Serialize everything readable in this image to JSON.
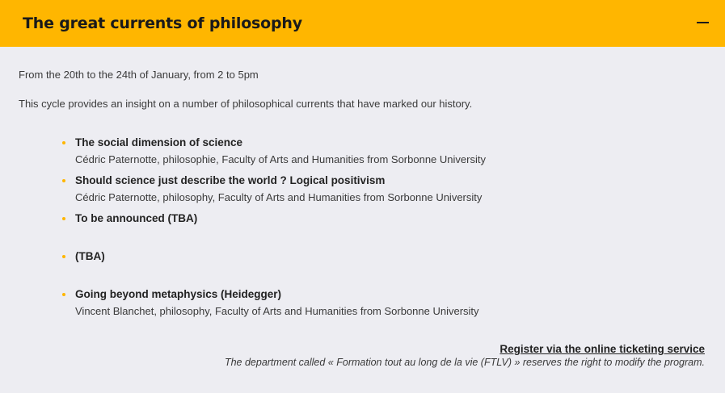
{
  "header": {
    "title": "The great currents of philosophy",
    "collapse_icon": "minus-icon"
  },
  "content": {
    "dates": "From the 20th to the 24th of January, from 2 to 5pm",
    "intro": "This cycle provides an insight on a number of philosophical currents that have marked our history.",
    "sessions": [
      {
        "title": "The social dimension of science",
        "speaker": "Cédric Paternotte, philosophie, Faculty of Arts and Humanities from Sorbonne University"
      },
      {
        "title": "Should science just describe the world ? Logical positivism",
        "speaker": "Cédric Paternotte, philosophy, Faculty of Arts and Humanities from Sorbonne University"
      },
      {
        "title": "To be announced (TBA)",
        "speaker": ""
      },
      {
        "title": "(TBA)",
        "speaker": ""
      },
      {
        "title": "Going beyond metaphysics (Heidegger)",
        "speaker": "Vincent Blanchet, philosophy, Faculty of Arts and Humanities from Sorbonne University"
      }
    ],
    "register_link": "Register via the online ticketing service",
    "disclaimer": "The department called « Formation tout au long de la vie (FTLV) » reserves the right to modify the program."
  },
  "colors": {
    "accent": "#ffb600",
    "background": "#ededf2"
  }
}
